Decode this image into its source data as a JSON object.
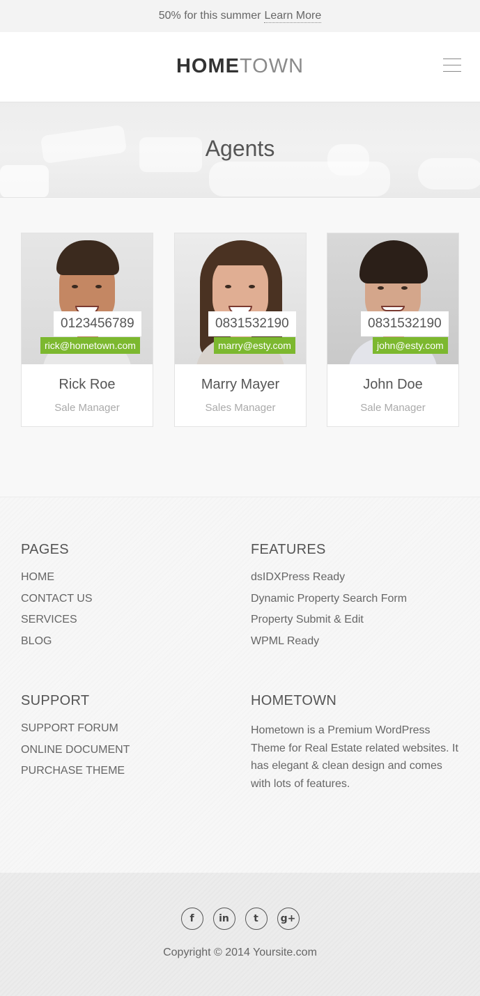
{
  "promo": {
    "text": "50% for this summer",
    "link": "Learn More"
  },
  "header": {
    "logo_part1": "HOME",
    "logo_part2": "TOWN",
    "menu_icon": "hamburger-icon"
  },
  "banner": {
    "title": "Agents"
  },
  "agents": [
    {
      "phone": "0123456789",
      "email": "rick@hometown.com",
      "name": "Rick Roe",
      "role": "Sale Manager"
    },
    {
      "phone": "0831532190",
      "email": "marry@esty.com",
      "name": "Marry Mayer",
      "role": "Sales Manager"
    },
    {
      "phone": "0831532190",
      "email": "john@esty.com",
      "name": "John Doe",
      "role": "Sale Manager"
    }
  ],
  "footer": {
    "pages": {
      "title": "PAGES",
      "items": [
        "HOME",
        "CONTACT US",
        "SERVICES",
        "BLOG"
      ]
    },
    "features": {
      "title": "FEATURES",
      "items": [
        "dsIDXPress Ready",
        "Dynamic Property Search Form",
        "Property Submit & Edit",
        "WPML Ready"
      ]
    },
    "support": {
      "title": "SUPPORT",
      "items": [
        "SUPPORT FORUM",
        "ONLINE DOCUMENT",
        "PURCHASE THEME"
      ]
    },
    "hometown": {
      "title": "HOMETOWN",
      "text": "Hometown is a Premium WordPress Theme for Real Estate related websites. It has elegant & clean design and comes with lots of features."
    }
  },
  "bottom": {
    "socials": [
      {
        "icon": "facebook-icon",
        "glyph": "f"
      },
      {
        "icon": "linkedin-icon",
        "glyph": "in"
      },
      {
        "icon": "twitter-icon",
        "glyph": "t"
      },
      {
        "icon": "google-plus-icon",
        "glyph": "g+"
      }
    ],
    "copyright": "Copyright © 2014 Yoursite.com"
  },
  "colors": {
    "accent_green": "#7cb82f"
  }
}
